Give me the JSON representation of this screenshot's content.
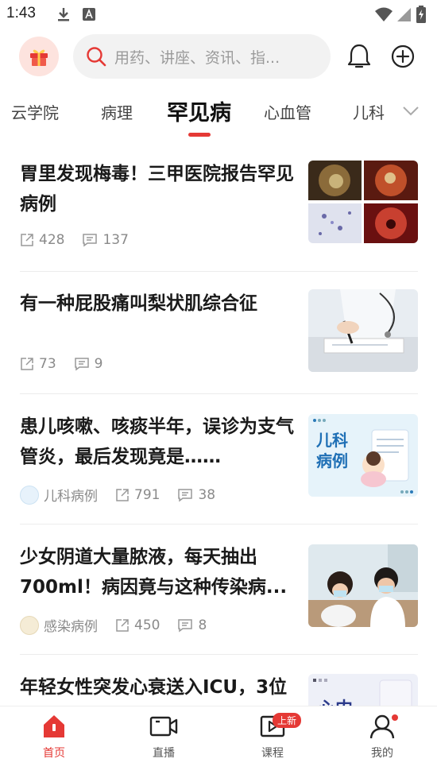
{
  "status_bar": {
    "time": "1:43"
  },
  "header": {
    "search_placeholder": "用药、讲座、资讯、指..."
  },
  "tabs": [
    {
      "label": "云学院"
    },
    {
      "label": "病理"
    },
    {
      "label": "罕见病"
    },
    {
      "label": "心血管"
    },
    {
      "label": "儿科"
    }
  ],
  "articles": [
    {
      "title": "胃里发现梅毒！三甲医院报告罕见病例",
      "shares": "428",
      "comments": "137"
    },
    {
      "title": "有一种屁股痛叫梨状肌综合征",
      "shares": "73",
      "comments": "9"
    },
    {
      "title": "患儿咳嗽、咳痰半年，误诊为支气管炎，最后发现竟是……",
      "source": "儿科病例",
      "shares": "791",
      "comments": "38",
      "thumb_text": "儿科\n病例"
    },
    {
      "title": "少女阴道大量脓液，每天抽出700ml！病因竟与这种传染病...",
      "source": "感染病例",
      "shares": "450",
      "comments": "8"
    },
    {
      "title": "年轻女性突发心衰送入ICU，3位",
      "thumb_text": "心内"
    }
  ],
  "bottom_nav": [
    {
      "label": "首页"
    },
    {
      "label": "直播"
    },
    {
      "label": "课程",
      "badge": "上新"
    },
    {
      "label": "我的"
    }
  ],
  "colors": {
    "accent": "#e53935"
  }
}
